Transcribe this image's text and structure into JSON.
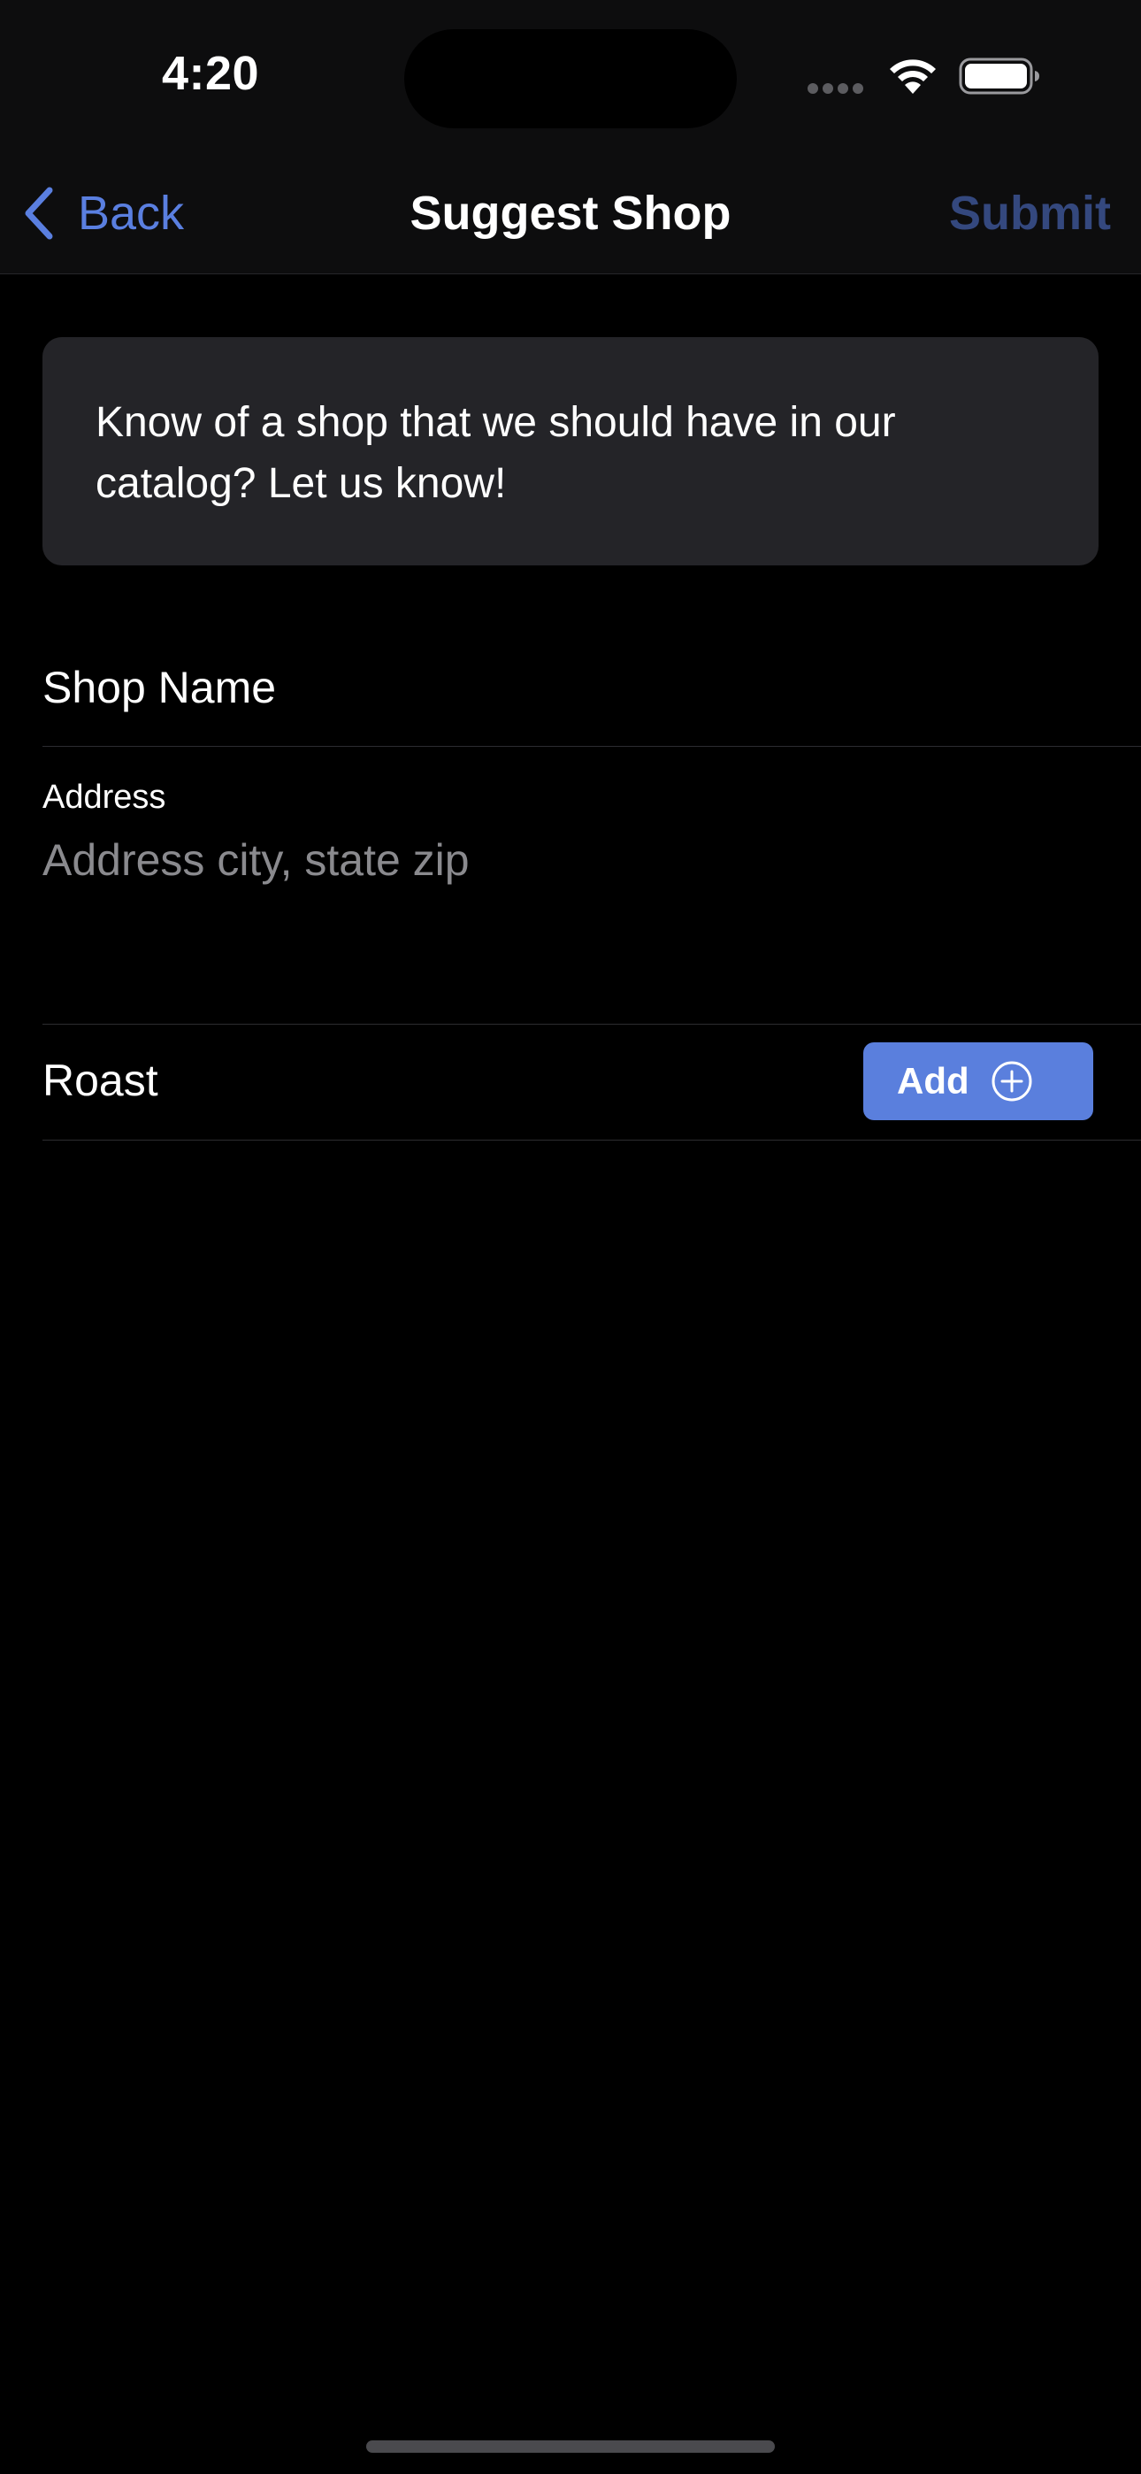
{
  "status_bar": {
    "time": "4:20"
  },
  "nav": {
    "back_label": "Back",
    "title": "Suggest Shop",
    "submit_label": "Submit"
  },
  "info_card": {
    "text": "Know of a shop that we should have in our catalog? Let us know!"
  },
  "form": {
    "shop_name": {
      "label": "Shop Name",
      "value": ""
    },
    "address": {
      "label": "Address",
      "value": "",
      "placeholder": "Address city, state zip"
    },
    "roast": {
      "label": "Roast",
      "add_label": "Add"
    }
  },
  "icons": {
    "back": "chevron-left-icon",
    "add": "plus-circle-icon",
    "wifi": "wifi-icon",
    "battery": "battery-icon"
  },
  "colors": {
    "accent": "#5a7fdd",
    "submit_disabled": "#34487e",
    "background": "#000000",
    "card": "#242428"
  }
}
